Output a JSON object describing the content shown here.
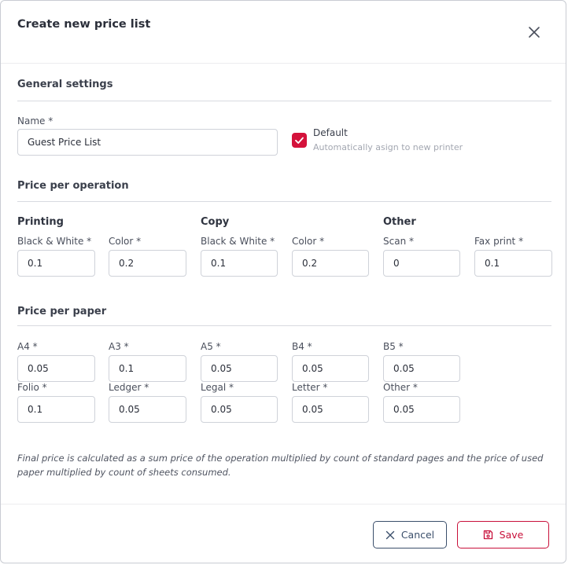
{
  "dialog": {
    "title": "Create new price list"
  },
  "general": {
    "title": "General settings",
    "name_label": "Name *",
    "name_value": "Guest Price List",
    "default_label": "Default",
    "default_hint": "Automatically asign to new printer",
    "default_checked": true
  },
  "operation": {
    "title": "Price per operation",
    "groups": {
      "printing": "Printing",
      "copy": "Copy",
      "other": "Other"
    },
    "fields": [
      {
        "label": "Black & White *",
        "value": "0.1"
      },
      {
        "label": "Color *",
        "value": "0.2"
      },
      {
        "label": "Black & White *",
        "value": "0.1"
      },
      {
        "label": "Color *",
        "value": "0.2"
      },
      {
        "label": "Scan *",
        "value": "0"
      },
      {
        "label": "Fax print *",
        "value": "0.1"
      }
    ]
  },
  "paper": {
    "title": "Price per paper",
    "fields": [
      {
        "label": "A4 *",
        "value": "0.05"
      },
      {
        "label": "A3 *",
        "value": "0.1"
      },
      {
        "label": "A5 *",
        "value": "0.05"
      },
      {
        "label": "B4 *",
        "value": "0.05"
      },
      {
        "label": "B5 *",
        "value": "0.05"
      },
      {
        "label": "Folio *",
        "value": "0.1"
      },
      {
        "label": "Ledger *",
        "value": "0.05"
      },
      {
        "label": "Legal *",
        "value": "0.05"
      },
      {
        "label": "Letter *",
        "value": "0.05"
      },
      {
        "label": "Other *",
        "value": "0.05"
      }
    ]
  },
  "note": "Final price is calculated as a sum price of the operation multiplied by count of standard pages and the price of used paper multiplied by count of sheets consumed.",
  "footer": {
    "cancel_label": "Cancel",
    "save_label": "Save"
  },
  "colors": {
    "accent": "#d4123b",
    "secondary": "#3b4f6b"
  },
  "icons": {
    "close": "close-icon",
    "check": "check-icon",
    "cancel": "x-icon",
    "save": "floppy-disk-icon"
  }
}
